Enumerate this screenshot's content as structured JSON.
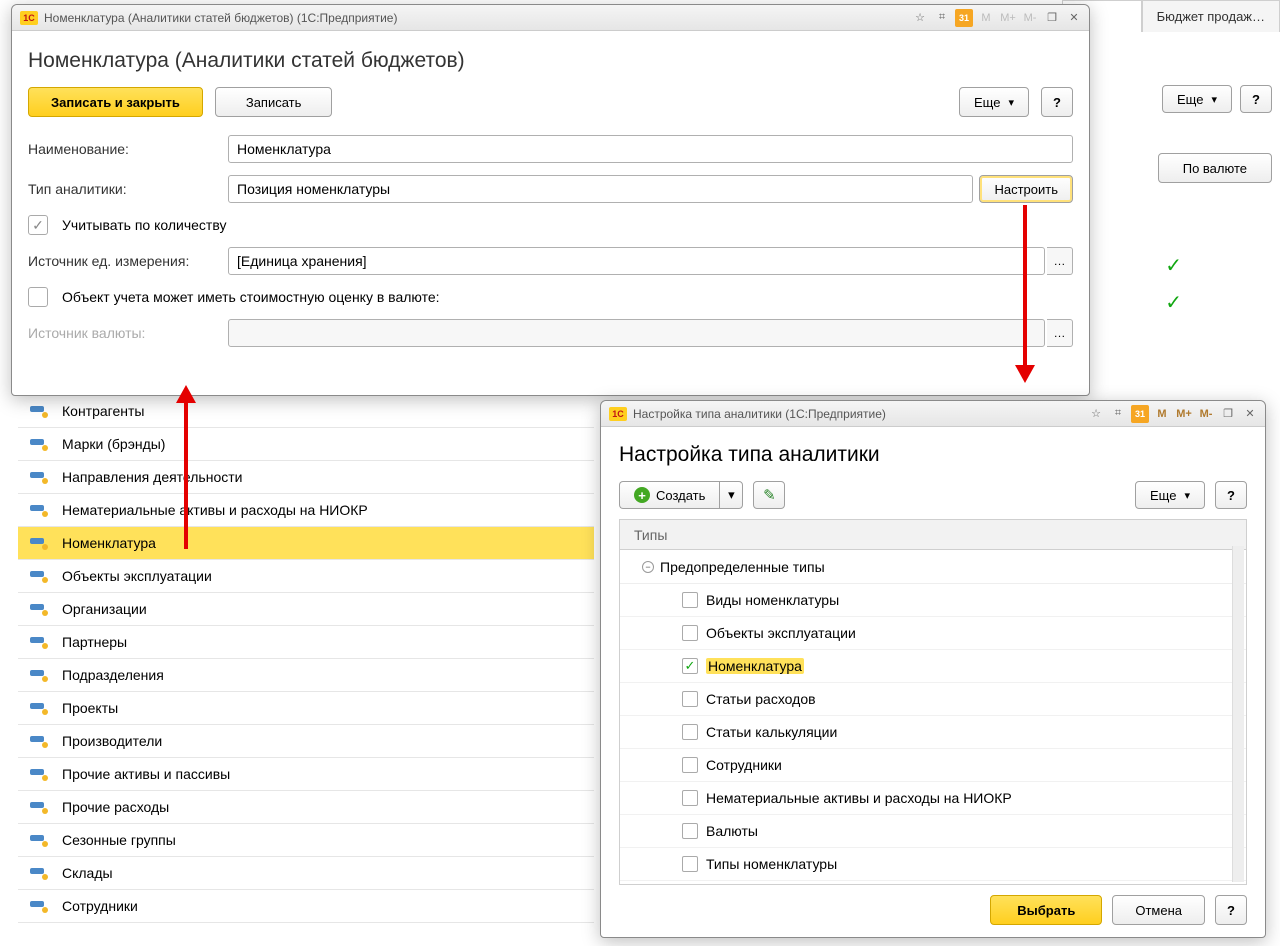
{
  "bg": {
    "tabs": [
      "…",
      "Бюджет продаж…"
    ],
    "more": "Еще",
    "col_currency": "По валюте",
    "close_x": "×"
  },
  "list": {
    "items": [
      {
        "label": "Контрагенты",
        "sel": false
      },
      {
        "label": "Марки (брэнды)",
        "sel": false
      },
      {
        "label": "Направления деятельности",
        "sel": false
      },
      {
        "label": "Нематериальные активы и расходы на НИОКР",
        "sel": false
      },
      {
        "label": "Номенклатура",
        "sel": true
      },
      {
        "label": "Объекты эксплуатации",
        "sel": false
      },
      {
        "label": "Организации",
        "sel": false
      },
      {
        "label": "Партнеры",
        "sel": false
      },
      {
        "label": "Подразделения",
        "sel": false
      },
      {
        "label": "Проекты",
        "sel": false
      },
      {
        "label": "Производители",
        "sel": false
      },
      {
        "label": "Прочие активы и пассивы",
        "sel": false
      },
      {
        "label": "Прочие расходы",
        "sel": false
      },
      {
        "label": "Сезонные группы",
        "sel": false
      },
      {
        "label": "Склады",
        "sel": false
      },
      {
        "label": "Сотрудники",
        "sel": false
      }
    ]
  },
  "dlg1": {
    "title_bar": "Номенклатура (Аналитики статей бюджетов)  (1С:Предприятие)",
    "heading": "Номенклатура (Аналитики статей бюджетов)",
    "save_close": "Записать и закрыть",
    "save": "Записать",
    "more": "Еще",
    "help": "?",
    "lab_name": "Наименование:",
    "val_name": "Номенклатура",
    "lab_type": "Тип аналитики:",
    "val_type": "Позиция номенклатуры",
    "btn_cfg": "Настроить",
    "chk_qty": "Учитывать по количеству",
    "lab_unit": "Источник ед. измерения:",
    "val_unit": "[Единица хранения]",
    "chk_val": "Объект учета может иметь стоимостную оценку в валюте:",
    "lab_cur": "Источник валюты:"
  },
  "dlg2": {
    "title_bar": "Настройка типа аналитики  (1С:Предприятие)",
    "heading": "Настройка типа аналитики",
    "create": "Создать",
    "more": "Еще",
    "help": "?",
    "grid_header": "Типы",
    "tree_root": "Предопределенные типы",
    "types": [
      {
        "label": "Виды номенклатуры",
        "checked": false,
        "hl": false
      },
      {
        "label": "Объекты эксплуатации",
        "checked": false,
        "hl": false
      },
      {
        "label": "Номенклатура",
        "checked": true,
        "hl": true
      },
      {
        "label": "Статьи расходов",
        "checked": false,
        "hl": false
      },
      {
        "label": "Статьи калькуляции",
        "checked": false,
        "hl": false
      },
      {
        "label": "Сотрудники",
        "checked": false,
        "hl": false
      },
      {
        "label": "Нематериальные активы и расходы на НИОКР",
        "checked": false,
        "hl": false
      },
      {
        "label": "Валюты",
        "checked": false,
        "hl": false
      },
      {
        "label": "Типы номенклатуры",
        "checked": false,
        "hl": false
      }
    ],
    "select": "Выбрать",
    "cancel": "Отмена"
  },
  "tb_icons": {
    "star": "☆",
    "calc": "⌗",
    "cal": "31",
    "m": "M",
    "mp": "M+",
    "mm": "M-",
    "win": "❐",
    "close": "✕",
    "min": "−"
  }
}
